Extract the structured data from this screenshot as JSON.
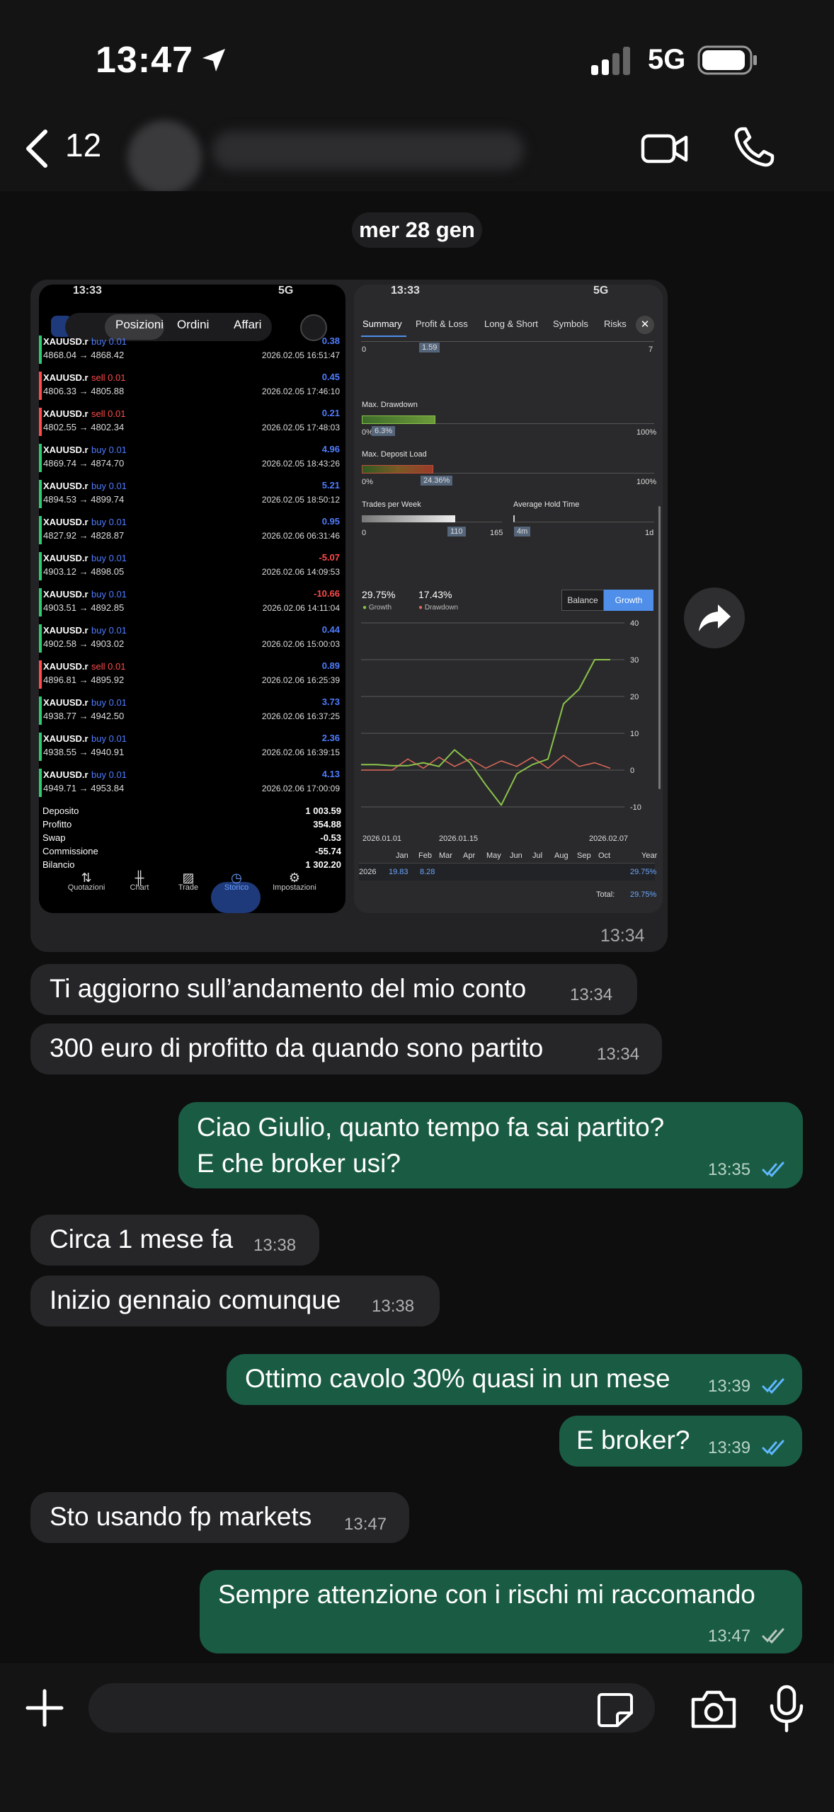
{
  "status_bar": {
    "time": "13:47",
    "network": "5G"
  },
  "header": {
    "back_count": "12"
  },
  "chat": {
    "date_label": "mer 28 gen",
    "image_message": {
      "time": "13:34"
    },
    "messages": [
      {
        "dir": "in",
        "text": "Ti aggiorno sull’andamento del mio conto",
        "time": "13:34"
      },
      {
        "dir": "in",
        "text": "300 euro di profitto da quando sono partito",
        "time": "13:34"
      },
      {
        "dir": "out",
        "text": "Ciao Giulio, quanto tempo fa sai partito?",
        "text2": "E che broker usi?",
        "time": "13:35"
      },
      {
        "dir": "in",
        "text": "Circa 1 mese fa",
        "time": "13:38"
      },
      {
        "dir": "in",
        "text": "Inizio gennaio comunque",
        "time": "13:38"
      },
      {
        "dir": "out",
        "text": "Ottimo cavolo 30% quasi in un mese",
        "time": "13:39"
      },
      {
        "dir": "out",
        "text": "E broker?",
        "time": "13:39"
      },
      {
        "dir": "in",
        "text": "Sto usando fp markets",
        "time": "13:47"
      },
      {
        "dir": "out",
        "text": "Sempre attenzione con i rischi mi raccomando",
        "time": "13:47"
      }
    ]
  },
  "left_shot": {
    "status_time": "13:33",
    "status_net": "5G",
    "tabs": [
      "Posizioni",
      "Ordini",
      "Affari"
    ],
    "selected_tab": "Posizioni",
    "trades": [
      {
        "sym": "XAUUSD.r",
        "side": "buy 0.01",
        "type": "buy",
        "prices": "4868.04 → 4868.42",
        "pl": "0.38",
        "date": "2026.02.05 16:51:47"
      },
      {
        "sym": "XAUUSD.r",
        "side": "sell 0.01",
        "type": "sell",
        "prices": "4806.33 → 4805.88",
        "pl": "0.45",
        "date": "2026.02.05 17:46:10"
      },
      {
        "sym": "XAUUSD.r",
        "side": "sell 0.01",
        "type": "sell",
        "prices": "4802.55 → 4802.34",
        "pl": "0.21",
        "date": "2026.02.05 17:48:03"
      },
      {
        "sym": "XAUUSD.r",
        "side": "buy 0.01",
        "type": "buy",
        "prices": "4869.74 → 4874.70",
        "pl": "4.96",
        "date": "2026.02.05 18:43:26"
      },
      {
        "sym": "XAUUSD.r",
        "side": "buy 0.01",
        "type": "buy",
        "prices": "4894.53 → 4899.74",
        "pl": "5.21",
        "date": "2026.02.05 18:50:12"
      },
      {
        "sym": "XAUUSD.r",
        "side": "buy 0.01",
        "type": "buy",
        "prices": "4827.92 → 4828.87",
        "pl": "0.95",
        "date": "2026.02.06 06:31:46"
      },
      {
        "sym": "XAUUSD.r",
        "side": "buy 0.01",
        "type": "buy",
        "prices": "4903.12 → 4898.05",
        "pl": "-5.07",
        "date": "2026.02.06 14:09:53"
      },
      {
        "sym": "XAUUSD.r",
        "side": "buy 0.01",
        "type": "buy",
        "prices": "4903.51 → 4892.85",
        "pl": "-10.66",
        "date": "2026.02.06 14:11:04"
      },
      {
        "sym": "XAUUSD.r",
        "side": "buy 0.01",
        "type": "buy",
        "prices": "4902.58 → 4903.02",
        "pl": "0.44",
        "date": "2026.02.06 15:00:03"
      },
      {
        "sym": "XAUUSD.r",
        "side": "sell 0.01",
        "type": "sell",
        "prices": "4896.81 → 4895.92",
        "pl": "0.89",
        "date": "2026.02.06 16:25:39"
      },
      {
        "sym": "XAUUSD.r",
        "side": "buy 0.01",
        "type": "buy",
        "prices": "4938.77 → 4942.50",
        "pl": "3.73",
        "date": "2026.02.06 16:37:25"
      },
      {
        "sym": "XAUUSD.r",
        "side": "buy 0.01",
        "type": "buy",
        "prices": "4938.55 → 4940.91",
        "pl": "2.36",
        "date": "2026.02.06 16:39:15"
      },
      {
        "sym": "XAUUSD.r",
        "side": "buy 0.01",
        "type": "buy",
        "prices": "4949.71 → 4953.84",
        "pl": "4.13",
        "date": "2026.02.06 17:00:09"
      }
    ],
    "summary": [
      {
        "label": "Deposito",
        "value": "1 003.59"
      },
      {
        "label": "Profitto",
        "value": "354.88"
      },
      {
        "label": "Swap",
        "value": "-0.53"
      },
      {
        "label": "Commissione",
        "value": "-55.74"
      },
      {
        "label": "Bilancio",
        "value": "1 302.20"
      }
    ],
    "bottom_nav": [
      "Quotazioni",
      "Chart",
      "Trade",
      "Storico",
      "Impostazioni"
    ],
    "selected_nav": "Storico"
  },
  "right_shot": {
    "status_time": "13:33",
    "status_net": "5G",
    "tabs": [
      "Summary",
      "Profit & Loss",
      "Long & Short",
      "Symbols",
      "Risks"
    ],
    "top_scale": {
      "min": "0",
      "marker": "1.59",
      "max": "7"
    },
    "max_drawdown": {
      "label": "Max. Drawdown",
      "min": "0%",
      "value": "6.3%",
      "max": "100%",
      "level": 0.063
    },
    "max_deposit_load": {
      "label": "Max. Deposit Load",
      "min": "0%",
      "value": "24.36%",
      "max": "100%",
      "level": 0.2436
    },
    "trades_per_week": {
      "label": "Trades per Week",
      "min": "0",
      "value": "110",
      "max": "165",
      "level": 0.667
    },
    "avg_hold_time": {
      "label": "Average Hold Time",
      "value": "4m",
      "max": "1d"
    },
    "growth_value": "29.75%",
    "growth_label": "Growth",
    "drawdown_value": "17.43%",
    "drawdown_label": "Drawdown",
    "toggle": [
      "Balance",
      "Growth"
    ],
    "toggle_selected": "Growth",
    "colors": {
      "growth": "#8bc34a",
      "drawdown": "#e06a5a",
      "accent": "#4f8fea"
    },
    "chart_data": {
      "type": "line",
      "x_ticks": [
        "2026.01.01",
        "2026.01.15",
        "2026.02.07"
      ],
      "y_ticks": [
        "40",
        "30",
        "20",
        "10",
        "0",
        "-10"
      ],
      "ylim": [
        -10,
        40
      ],
      "series": [
        {
          "name": "Growth",
          "values": [
            1.5,
            1.5,
            1.2,
            1.2,
            2.0,
            1.0,
            5.5,
            2.0,
            -4.0,
            -9.5,
            -1.0,
            1.5,
            3.0,
            18.0,
            22.0,
            30.0,
            30.0
          ]
        },
        {
          "name": "Drawdown",
          "values": [
            0,
            0,
            0,
            3.0,
            0.5,
            3.5,
            1.0,
            3.0,
            0.5,
            2.5,
            1.0,
            3.5,
            0.5,
            4.0,
            1.0,
            2.0,
            0.5
          ]
        }
      ]
    },
    "months_header": [
      "Jan",
      "Feb",
      "Mar",
      "Apr",
      "May",
      "Jun",
      "Jul",
      "Aug",
      "Sep",
      "Oct",
      "Year"
    ],
    "year_row": {
      "year": "2026",
      "jan": "19.83",
      "feb": "8.28",
      "year_total": "29.75%"
    },
    "total_label": "Total:",
    "total_value": "29.75%"
  }
}
